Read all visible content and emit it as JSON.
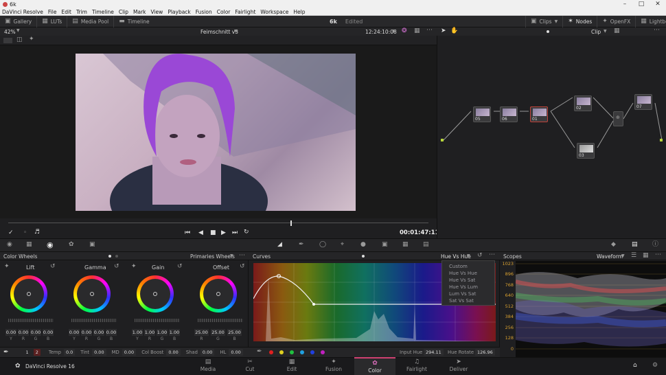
{
  "window": {
    "title": "6k"
  },
  "menu": [
    "DaVinci Resolve",
    "File",
    "Edit",
    "Trim",
    "Timeline",
    "Clip",
    "Mark",
    "View",
    "Playback",
    "Fusion",
    "Color",
    "Fairlight",
    "Workspace",
    "Help"
  ],
  "toolbar": {
    "left": [
      {
        "icon": "gallery-icon",
        "label": "Gallery"
      },
      {
        "icon": "luts-icon",
        "label": "LUTs"
      },
      {
        "icon": "media-pool-icon",
        "label": "Media Pool"
      },
      {
        "icon": "timeline-icon",
        "label": "Timeline"
      }
    ],
    "project_name": "6k",
    "project_status": "Edited",
    "right": [
      {
        "icon": "clips-icon",
        "label": "Clips"
      },
      {
        "icon": "nodes-icon",
        "label": "Nodes"
      },
      {
        "icon": "openfx-icon",
        "label": "OpenFX"
      },
      {
        "icon": "lightbox-icon",
        "label": "Lightbox"
      }
    ]
  },
  "viewer": {
    "zoom": "42%",
    "timeline_name": "Feimschnitt v3",
    "timecode_top": "12:24:10:08",
    "timecode": "00:01:47:11"
  },
  "nodes": {
    "mode": "Clip",
    "items": [
      "05",
      "06",
      "01",
      "02",
      "03",
      "07"
    ]
  },
  "color_wheels": {
    "title": "Color Wheels",
    "mode": "Primaries Wheels",
    "wheels": [
      {
        "name": "Lift",
        "values": [
          "0.00",
          "0.00",
          "0.00",
          "0.00"
        ]
      },
      {
        "name": "Gamma",
        "values": [
          "0.00",
          "0.00",
          "0.00",
          "0.00"
        ]
      },
      {
        "name": "Gain",
        "values": [
          "1.00",
          "1.00",
          "1.00",
          "1.00"
        ]
      },
      {
        "name": "Offset",
        "values": [
          "25.00",
          "25.00",
          "25.00"
        ]
      }
    ],
    "channel_labels": [
      "Y",
      "R",
      "G",
      "B"
    ],
    "offset_labels": [
      "R",
      "G",
      "B"
    ],
    "bottom": {
      "page1": "1",
      "page2": "2",
      "temp_label": "Temp",
      "temp": "0.0",
      "tint_label": "Tint",
      "tint": "0.00",
      "md_label": "MD",
      "md": "0.00",
      "colboost_label": "Col Boost",
      "colboost": "0.00",
      "shad_label": "Shad",
      "shad": "0.00",
      "hl_label": "HL",
      "hl": "0.00"
    }
  },
  "curves": {
    "title": "Curves",
    "mode": "Hue Vs Hue",
    "dropdown": [
      "Custom",
      "Hue Vs Hue",
      "Hue Vs Sat",
      "Hue Vs Lum",
      "Lum Vs Sat",
      "Sat Vs Sat"
    ],
    "input_hue_label": "Input Hue",
    "input_hue": "294.11",
    "hue_rotate_label": "Hue Rotate",
    "hue_rotate": "126.96",
    "swatches": [
      "#e02020",
      "#e0d020",
      "#20c040",
      "#20a0e0",
      "#2040e0",
      "#c020c0"
    ]
  },
  "scopes": {
    "title": "Scopes",
    "mode": "Waveform",
    "scale": [
      "1023",
      "896",
      "768",
      "640",
      "512",
      "384",
      "256",
      "128",
      "0"
    ]
  },
  "bottom_bar": {
    "app": "DaVinci Resolve 16",
    "pages": [
      {
        "icon": "media-icon",
        "label": "Media"
      },
      {
        "icon": "cut-icon",
        "label": "Cut"
      },
      {
        "icon": "edit-icon",
        "label": "Edit"
      },
      {
        "icon": "fusion-icon",
        "label": "Fusion"
      },
      {
        "icon": "color-icon",
        "label": "Color"
      },
      {
        "icon": "fairlight-icon",
        "label": "Fairlight"
      },
      {
        "icon": "deliver-icon",
        "label": "Deliver"
      }
    ]
  }
}
